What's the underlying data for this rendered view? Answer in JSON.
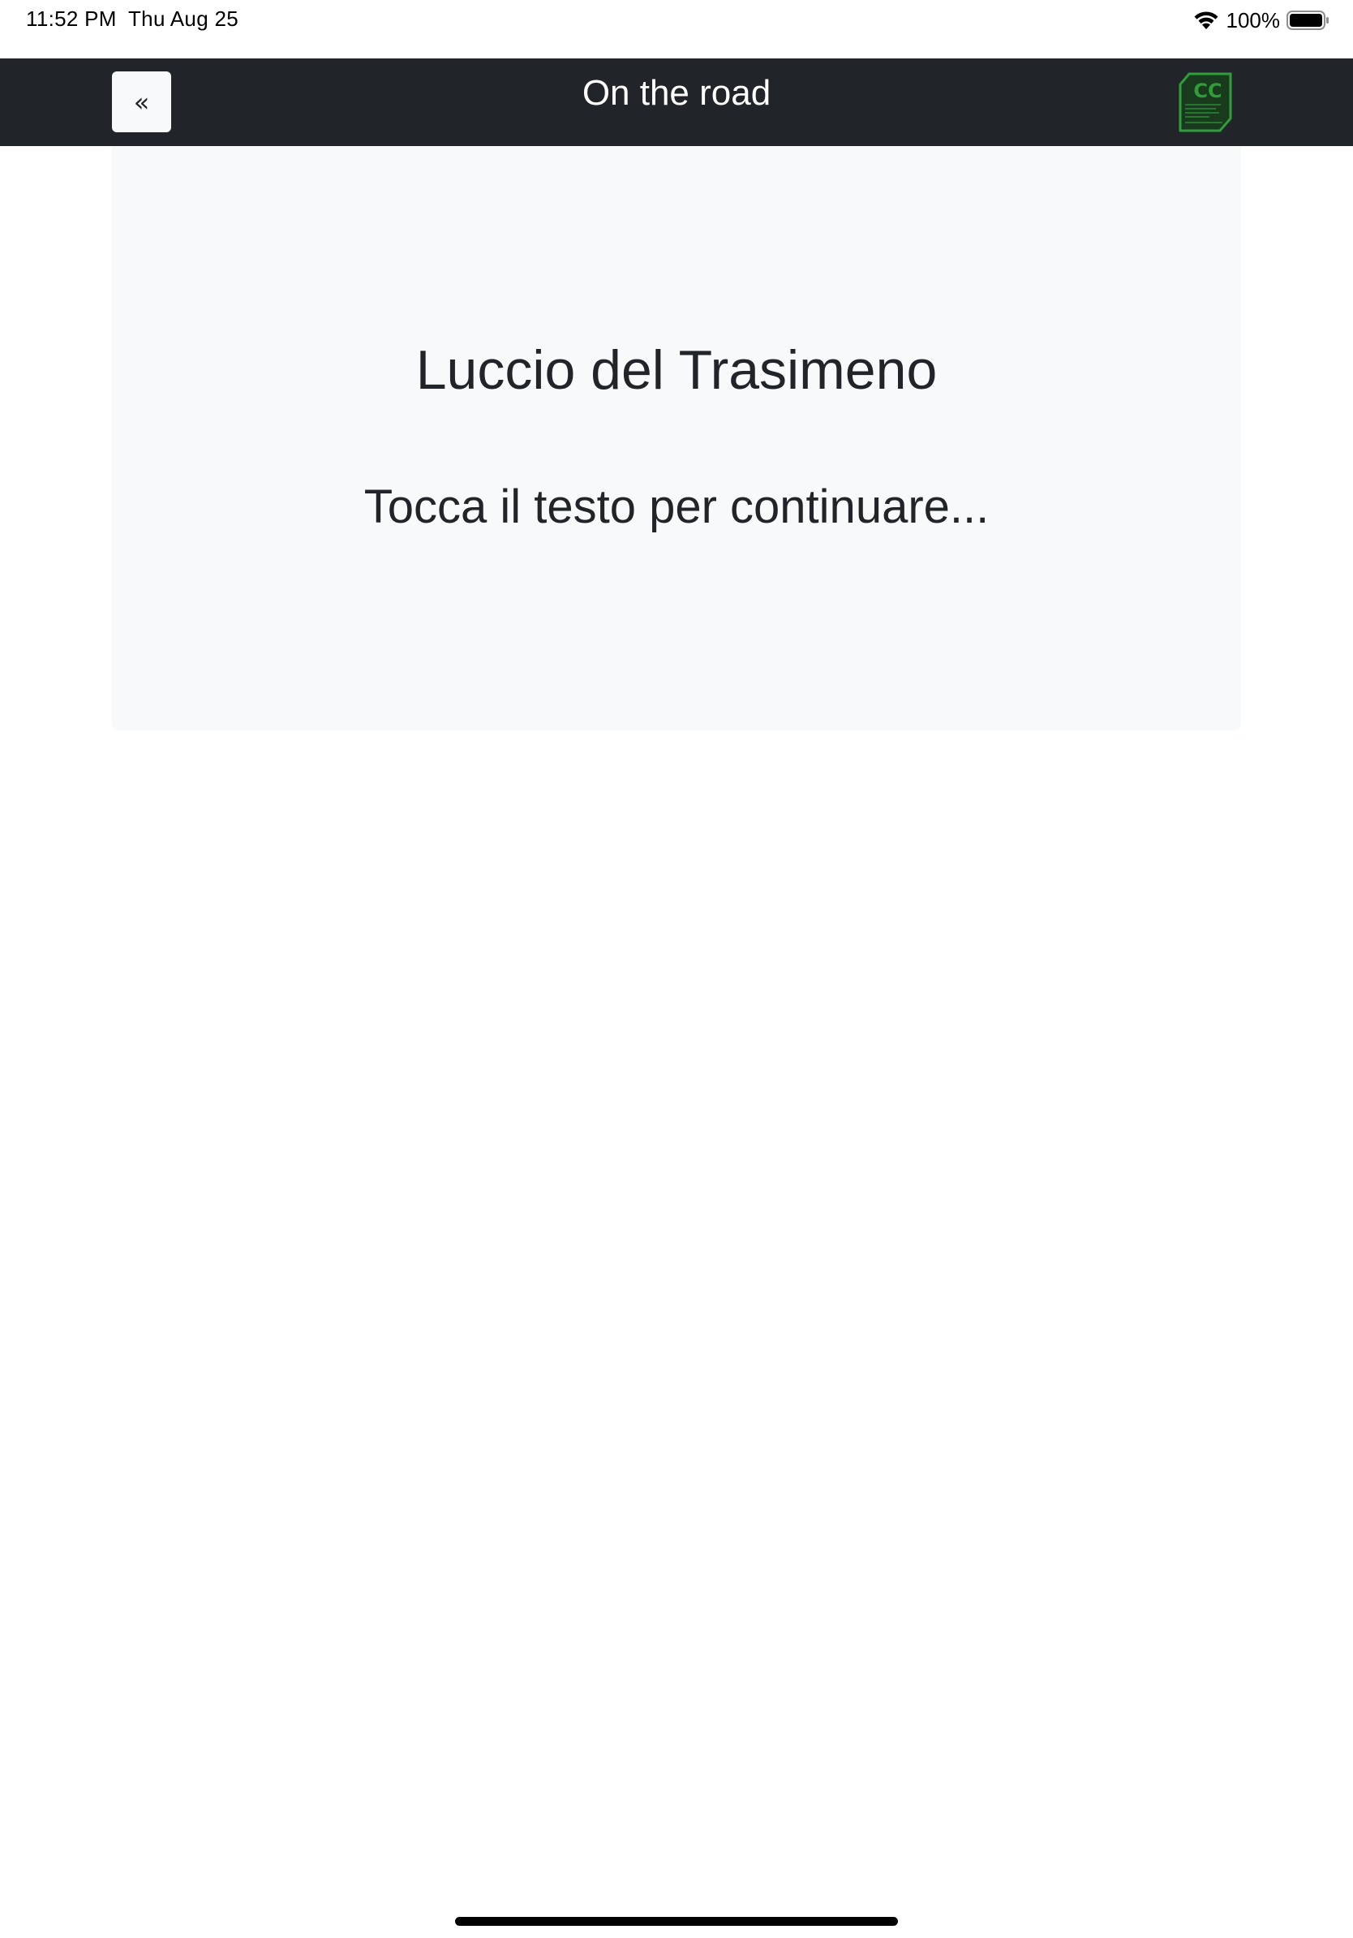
{
  "status_bar": {
    "time": "11:52 PM",
    "date": "Thu Aug 25",
    "battery_percent": "100%",
    "wifi_icon": "wifi-icon",
    "battery_icon": "battery-full-icon"
  },
  "navbar": {
    "back_label": "«",
    "title": "On the road",
    "logo_icon": "cc-logo-icon",
    "background_color": "#212529",
    "logo_color": "#2f9e3a"
  },
  "card": {
    "title": "Luccio del Trasimeno",
    "subtitle": "Tocca il testo per continuare...",
    "background_color": "#f8f9fa"
  }
}
